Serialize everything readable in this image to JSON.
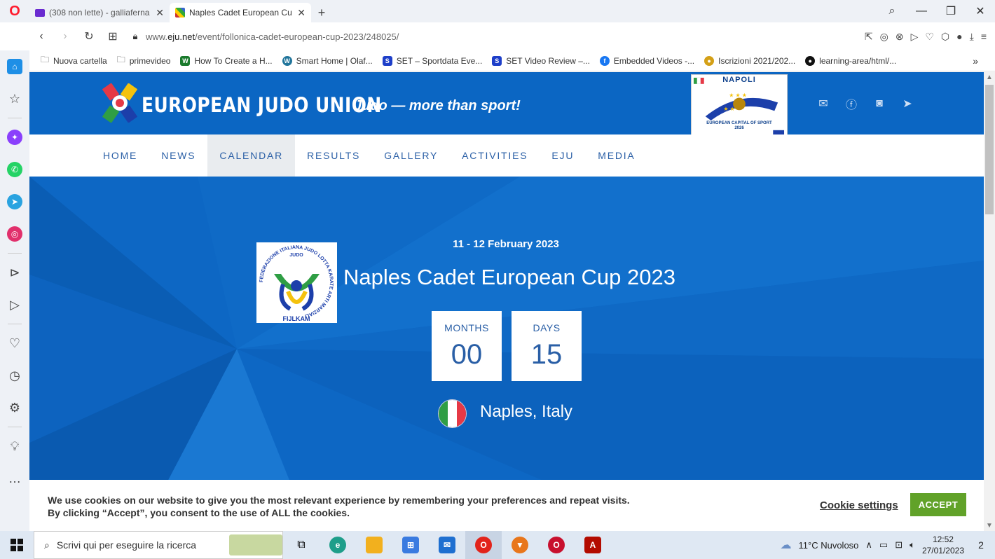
{
  "browser": {
    "tabs": [
      {
        "title": "(308 non lette) - galliaferna",
        "active": false,
        "icon": "mail-icon"
      },
      {
        "title": "Naples Cadet European Cu",
        "active": true,
        "icon": "eju-favicon"
      }
    ],
    "url_prefix": "www.",
    "url_domain": "eju.net",
    "url_path": "/event/follonica-cadet-european-cup-2023/248025/",
    "bookmarks": [
      "Nuova cartella",
      "primevideo",
      "How To Create a H...",
      "Smart Home | Olaf...",
      "SET – Sportdata Eve...",
      "SET Video Review –...",
      "Embedded Videos -...",
      "Iscrizioni 2021/202...",
      "learning-area/html/..."
    ],
    "bookmarks_more": "»"
  },
  "site": {
    "brand": "EUROPEAN JUDO UNION",
    "tagline": "Judo — more than sport!",
    "napoli_title": "NAPOLI",
    "napoli_line": "EUROPEAN CAPITAL OF SPORT",
    "napoli_year": "2026",
    "nav": [
      "HOME",
      "NEWS",
      "CALENDAR",
      "RESULTS",
      "GALLERY",
      "ACTIVITIES",
      "EJU",
      "MEDIA"
    ],
    "nav_active": "CALENDAR"
  },
  "event": {
    "date": "11 - 12 February 2023",
    "title": "Naples Cadet European Cup 2023",
    "months_label": "MONTHS",
    "months_value": "00",
    "days_label": "DAYS",
    "days_value": "15",
    "place": "Naples, Italy",
    "federation": "FIJLKAM",
    "federation_ring": "FEDERAZIONE ITALIANA JUDO LOTTA KARATE ARTI MARZIALI",
    "federation_judo": "JUDO"
  },
  "cookie": {
    "line1": "We use cookies on our website to give you the most relevant experience by remembering your preferences and repeat visits.",
    "line2": "By clicking “Accept”, you consent to the use of ALL the cookies.",
    "settings": "Cookie settings",
    "accept": "ACCEPT"
  },
  "taskbar": {
    "search_placeholder": "Scrivi qui per eseguire la ricerca",
    "weather": "11°C  Nuvoloso",
    "time": "12:52",
    "date": "27/01/2023",
    "notifications": "2"
  },
  "colors": {
    "brand_blue": "#0b66c3",
    "nav_text": "#2a5fa6",
    "accept_green": "#61a229"
  }
}
